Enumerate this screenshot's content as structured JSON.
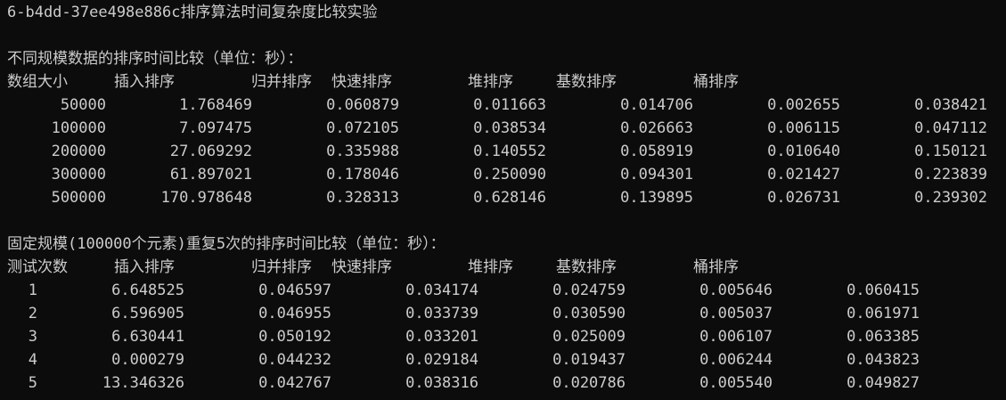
{
  "title_line": "6-b4dd-37ee498e886c排序算法时间复杂度比较实验",
  "section1": {
    "heading": "不同规模数据的排序时间比较（单位：秒）：",
    "headers": [
      "数组大小",
      "插入排序",
      "归并排序",
      "快速排序",
      "堆排序",
      "基数排序",
      "桶排序"
    ],
    "rows": [
      [
        "50000",
        "1.768469",
        "0.060879",
        "0.011663",
        "0.014706",
        "0.002655",
        "0.038421"
      ],
      [
        "100000",
        "7.097475",
        "0.072105",
        "0.038534",
        "0.026663",
        "0.006115",
        "0.047112"
      ],
      [
        "200000",
        "27.069292",
        "0.335988",
        "0.140552",
        "0.058919",
        "0.010640",
        "0.150121"
      ],
      [
        "300000",
        "61.897021",
        "0.178046",
        "0.250090",
        "0.094301",
        "0.021427",
        "0.223839"
      ],
      [
        "500000",
        "170.978648",
        "0.328313",
        "0.628146",
        "0.139895",
        "0.026731",
        "0.239302"
      ]
    ]
  },
  "section2": {
    "heading": "固定规模(100000个元素)重复5次的排序时间比较（单位：秒）：",
    "headers": [
      "测试次数",
      "插入排序",
      "归并排序",
      "快速排序",
      "堆排序",
      "基数排序",
      "桶排序"
    ],
    "rows": [
      [
        "1",
        "6.648525",
        "0.046597",
        "0.034174",
        "0.024759",
        "0.005646",
        "0.060415"
      ],
      [
        "2",
        "6.596905",
        "0.046955",
        "0.033739",
        "0.030590",
        "0.005037",
        "0.061971"
      ],
      [
        "3",
        "6.630441",
        "0.050192",
        "0.033201",
        "0.025009",
        "0.006107",
        "0.063385"
      ],
      [
        "4",
        "0.000279",
        "0.044232",
        "0.029184",
        "0.019437",
        "0.006244",
        "0.043823"
      ],
      [
        "5",
        "13.346326",
        "0.042767",
        "0.038316",
        "0.020786",
        "0.005540",
        "0.049827"
      ]
    ]
  }
}
